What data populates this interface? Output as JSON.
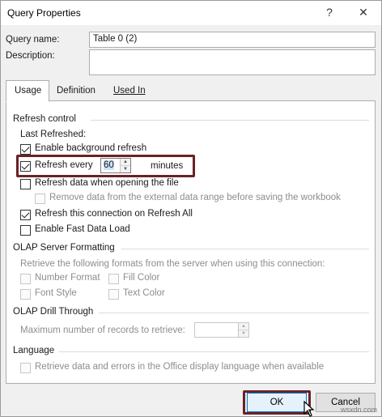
{
  "window": {
    "title": "Query Properties",
    "help_glyph": "?",
    "close_glyph": "✕"
  },
  "query": {
    "name_label": "Query name:",
    "name_value": "Table 0 (2)",
    "description_label": "Description:",
    "description_value": ""
  },
  "tabs": [
    {
      "label": "Usage",
      "active": true
    },
    {
      "label": "Definition",
      "active": false
    },
    {
      "label": "Used In",
      "active": false
    }
  ],
  "refresh_control": {
    "title": "Refresh control",
    "last_refreshed_label": "Last Refreshed:",
    "enable_background": {
      "label": "Enable background refresh",
      "checked": true
    },
    "refresh_every": {
      "label": "Refresh every",
      "checked": true,
      "value": "60",
      "unit": "minutes"
    },
    "refresh_on_open": {
      "label": "Refresh data when opening the file",
      "checked": false
    },
    "remove_data": {
      "label": "Remove data from the external data range before saving the workbook",
      "checked": false,
      "disabled": true
    },
    "refresh_on_refresh_all": {
      "label": "Refresh this connection on Refresh All",
      "checked": true
    },
    "fast_data_load": {
      "label": "Enable Fast Data Load",
      "checked": false
    }
  },
  "olap_formatting": {
    "title": "OLAP Server Formatting",
    "description": "Retrieve the following formats from the server when using this connection:",
    "number_format": "Number Format",
    "fill_color": "Fill Color",
    "font_style": "Font Style",
    "text_color": "Text Color"
  },
  "olap_drill": {
    "title": "OLAP Drill Through",
    "max_records_label": "Maximum number of records to retrieve:",
    "max_records_value": ""
  },
  "language": {
    "title": "Language",
    "retrieve_label": "Retrieve data and errors in the Office display language when available"
  },
  "buttons": {
    "ok": "OK",
    "cancel": "Cancel"
  },
  "watermark": "wsxdn.com",
  "colors": {
    "highlight_border": "#6b2224",
    "ok_border": "#0078d7"
  }
}
